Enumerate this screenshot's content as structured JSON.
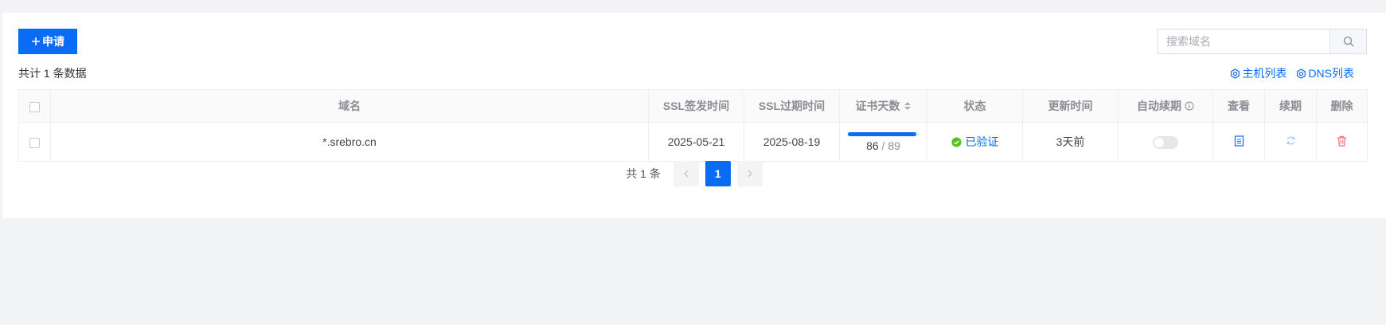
{
  "toolbar": {
    "apply_label": "申请",
    "search_placeholder": "搜索域名",
    "total_text": "共计 1 条数据",
    "host_list_label": "主机列表",
    "dns_list_label": "DNS列表"
  },
  "table": {
    "headers": {
      "domain": "域名",
      "ssl_issue": "SSL签发时间",
      "ssl_expire": "SSL过期时间",
      "cert_days": "证书天数",
      "status": "状态",
      "updated": "更新时间",
      "auto_renew": "自动续期",
      "view": "查看",
      "renew": "续期",
      "delete": "删除"
    },
    "rows": [
      {
        "domain": "*.srebro.cn",
        "ssl_issue": "2025-05-21",
        "ssl_expire": "2025-08-19",
        "days_left": "86",
        "days_sep": "/",
        "days_total": "89",
        "days_fraction": 0.966,
        "status": "已验证",
        "updated": "3天前",
        "auto_renew": false
      }
    ]
  },
  "pagination": {
    "total_text": "共 1 条",
    "current_page": "1"
  },
  "colors": {
    "primary": "#0a6cf5",
    "success": "#52c41a",
    "danger": "#f56c6c",
    "renew_icon": "#9ec5f8"
  },
  "icons": {
    "apply": "plus-icon",
    "search": "search-icon",
    "links": "gear-icon",
    "sort": "sort-icon",
    "info": "info-circle-icon",
    "status": "check-circle-icon",
    "view": "document-icon",
    "renew": "refresh-icon",
    "delete": "trash-icon",
    "prev": "chevron-left-icon",
    "next": "chevron-right-icon"
  }
}
